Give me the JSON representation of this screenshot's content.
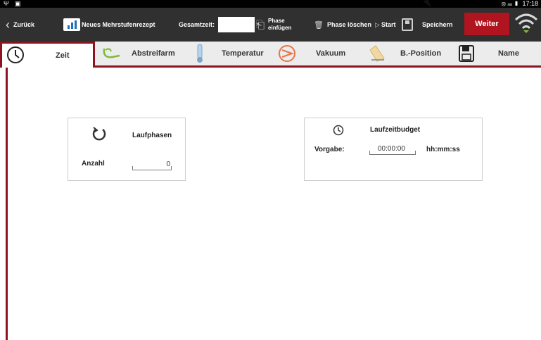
{
  "status_bar": {
    "left_icons": "Ψ ▣",
    "right_icons": "⦻ ☰ ▮",
    "time": "17:18"
  },
  "action_bar": {
    "back_label": "Zurück",
    "recipe_label": "Neues Mehrstufenrezept",
    "total_time_label": "Gesamtzeit:",
    "total_time_value": "",
    "phase_insert_label_line1": "Phase",
    "phase_insert_label_line2": "einfügen",
    "phase_delete_label": "Phase löschen",
    "start_label": "Start",
    "save_label": "Speichern",
    "next_label": "Weiter"
  },
  "tabs": [
    {
      "label": "Zeit",
      "icon": "clock-icon",
      "active": true
    },
    {
      "label": "Abstreifarm",
      "icon": "scraper-arm-icon",
      "active": false
    },
    {
      "label": "Temperatur",
      "icon": "thermometer-icon",
      "active": false
    },
    {
      "label": "Vakuum",
      "icon": "vacuum-icon",
      "active": false
    },
    {
      "label": "B.-Position",
      "icon": "bowl-position-icon",
      "active": false
    },
    {
      "label": "Name",
      "icon": "save-icon",
      "active": false
    }
  ],
  "cycles_card": {
    "title": "Laufphasen",
    "count_label": "Anzahl",
    "count_value": "0"
  },
  "budget_card": {
    "title": "Laufzeitbudget",
    "target_label": "Vorgabe:",
    "target_value": "00:00:00",
    "format_hint": "hh:mm:ss"
  },
  "colors": {
    "accent": "#8c1420",
    "next_button": "#b0141f",
    "action_bar": "#303030",
    "tab_bar": "#ececec"
  }
}
